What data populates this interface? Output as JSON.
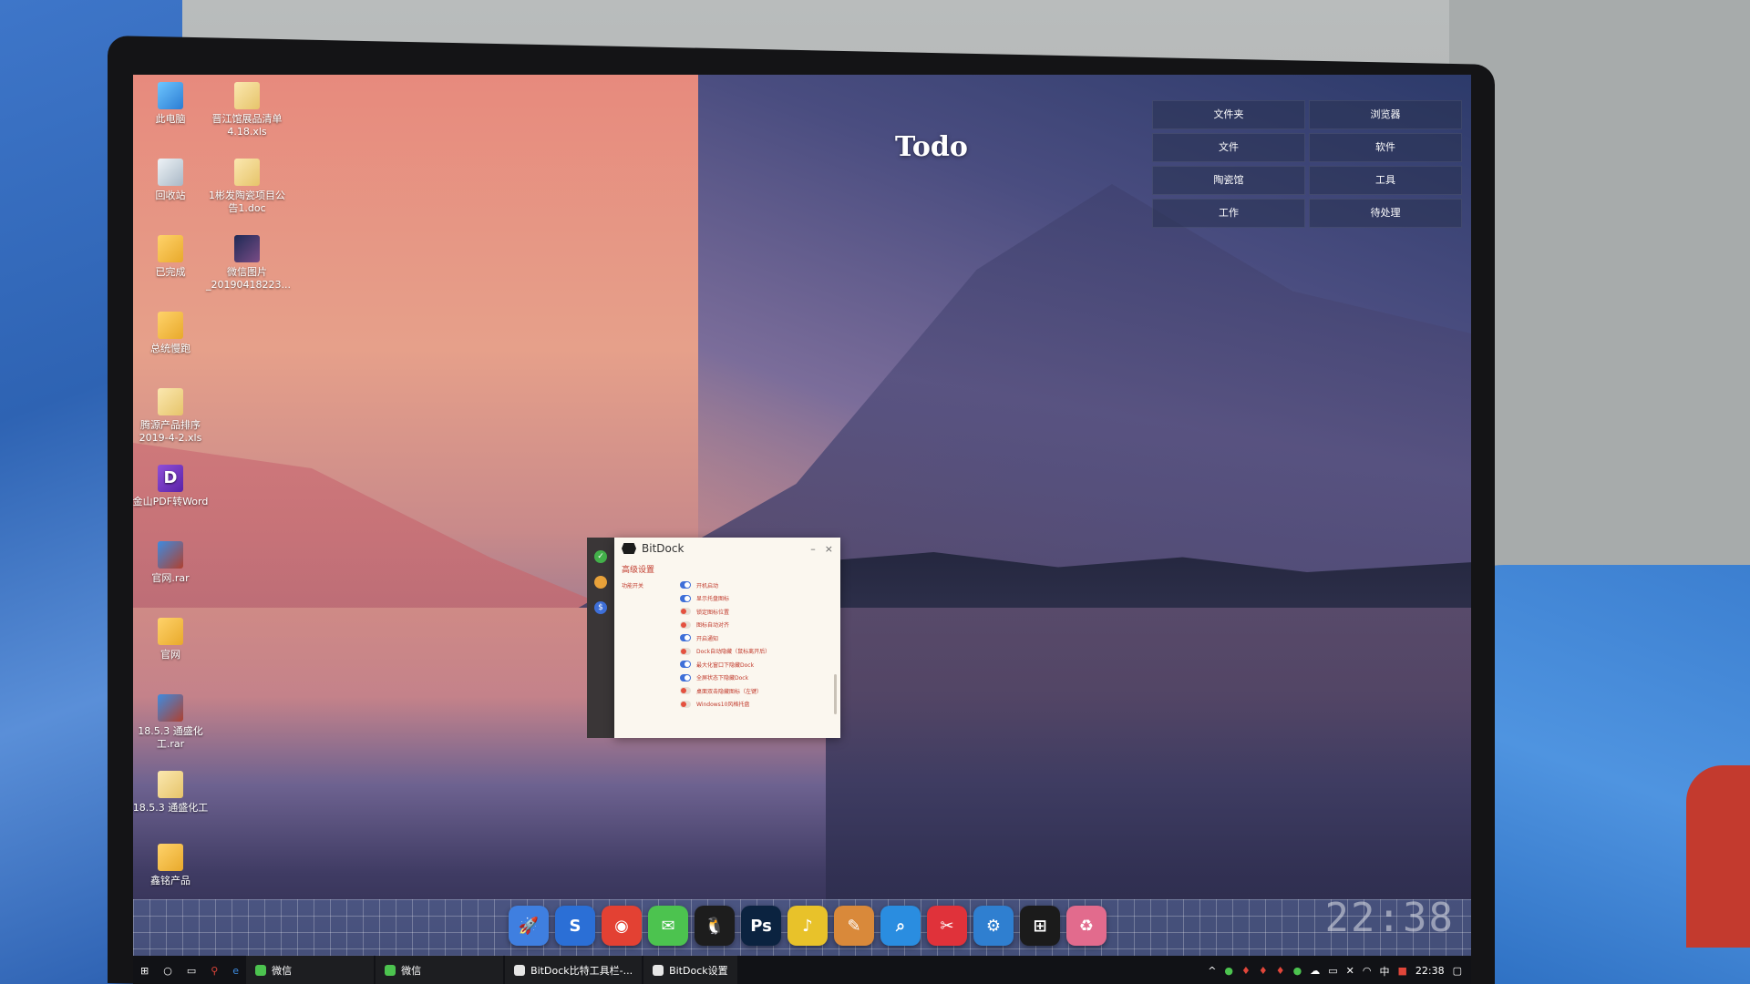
{
  "desktop_icons": [
    {
      "label": "此电脑",
      "glyph": "pc-icon"
    },
    {
      "label": "晋江馆展品清单4.18.xls",
      "glyph": "excel-file-icon"
    },
    {
      "label": "回收站",
      "glyph": "recycle-bin-icon"
    },
    {
      "label": "1彬发陶瓷项目公告1.doc",
      "glyph": "doc-file-icon"
    },
    {
      "label": "已完成",
      "glyph": "folder-icon"
    },
    {
      "label": "微信图片_20190418223...",
      "glyph": "image-file-icon"
    },
    {
      "label": "总统慢跑",
      "glyph": "folder-icon"
    },
    {
      "label": "腾源产品排序2019-4-2.xls",
      "glyph": "excel-file-icon"
    },
    {
      "label": "金山PDF转Word",
      "glyph": "pdf-word-icon"
    },
    {
      "label": "官网.rar",
      "glyph": "rar-file-icon"
    },
    {
      "label": "官网",
      "glyph": "folder-icon"
    },
    {
      "label": "18.5.3 通盛化工.rar",
      "glyph": "rar-file-icon"
    },
    {
      "label": "18.5.3 通盛化工",
      "glyph": "folder-icon"
    },
    {
      "label": "鑫铭产品",
      "glyph": "folder-icon"
    }
  ],
  "todo": {
    "title": "Todo",
    "cells": [
      "文件夹",
      "浏览器",
      "文件",
      "软件",
      "陶瓷馆",
      "工具",
      "工作",
      "待处理"
    ]
  },
  "bitdock": {
    "title": "BitDock",
    "minimize": "–",
    "close": "×",
    "section": "高级设置",
    "group_label": "功能开关",
    "rows": [
      {
        "label": "开机启动",
        "on": true
      },
      {
        "label": "显示托盘图标",
        "on": true
      },
      {
        "label": "锁定图标位置",
        "on": false
      },
      {
        "label": "图标自动对齐",
        "on": false
      },
      {
        "label": "开启通知",
        "on": true
      },
      {
        "label": "Dock自动隐藏（鼠标离开后）",
        "on": false
      },
      {
        "label": "最大化窗口下隐藏Dock",
        "on": true
      },
      {
        "label": "全屏状态下隐藏Dock",
        "on": true
      },
      {
        "label": "桌面双击隐藏图标（左键）",
        "on": false
      },
      {
        "label": "Windows10风格托盘",
        "on": false
      }
    ]
  },
  "dock": {
    "clock": "22:38",
    "apps": [
      {
        "name": "rocket-app-icon",
        "glyph": "🚀",
        "color": "#3f7fe0"
      },
      {
        "name": "sogou-browser-icon",
        "glyph": "S",
        "color": "#2b6fd6"
      },
      {
        "name": "chrome-icon",
        "glyph": "◉",
        "color": "#e34133"
      },
      {
        "name": "wechat-icon",
        "glyph": "✉",
        "color": "#4cc34f"
      },
      {
        "name": "qq-icon",
        "glyph": "🐧",
        "color": "#1d1d1d"
      },
      {
        "name": "photoshop-icon",
        "glyph": "Ps",
        "color": "#0b2340"
      },
      {
        "name": "music-icon",
        "glyph": "♪",
        "color": "#e8c22a"
      },
      {
        "name": "notes-icon",
        "glyph": "✎",
        "color": "#d9893a"
      },
      {
        "name": "search-app-icon",
        "glyph": "⌕",
        "color": "#2a8de0"
      },
      {
        "name": "screenshot-app-icon",
        "glyph": "✂",
        "color": "#e0323a"
      },
      {
        "name": "settings-app-icon",
        "glyph": "⚙",
        "color": "#2f7fd0"
      },
      {
        "name": "windows-app-icon",
        "glyph": "⊞",
        "color": "#1b1b1b"
      },
      {
        "name": "recycle-app-icon",
        "glyph": "♻",
        "color": "#e26b8d"
      }
    ]
  },
  "taskbar": {
    "apps": [
      {
        "label": "微信",
        "color": "#4cc34f"
      },
      {
        "label": "微信",
        "color": "#4cc34f"
      },
      {
        "label": "BitDock比特工具栏-...",
        "color": "#e6e6e6"
      },
      {
        "label": "BitDock设置",
        "color": "#e6e6e6"
      }
    ],
    "ime": "中",
    "time": "22:38"
  }
}
